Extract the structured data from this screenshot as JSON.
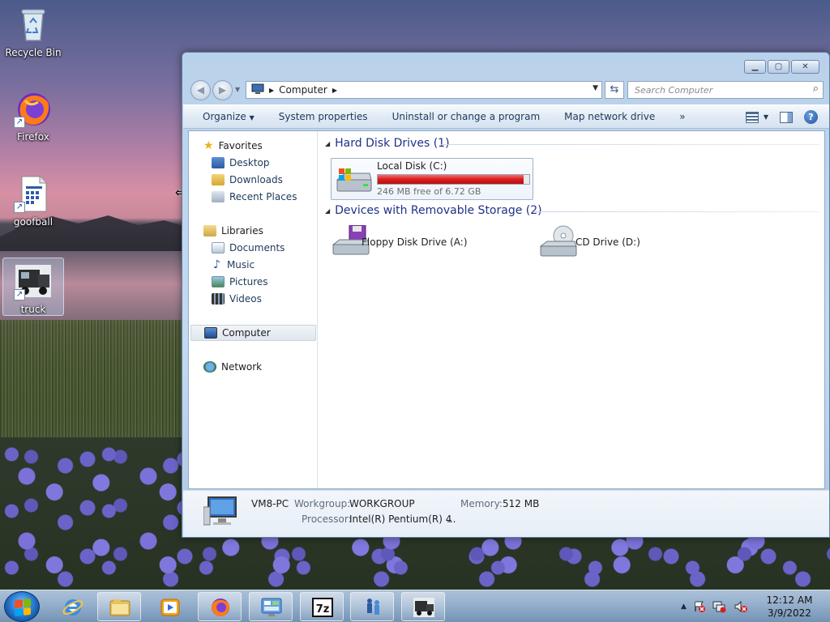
{
  "desktop": {
    "icons": [
      {
        "label": "Recycle Bin"
      },
      {
        "label": "Firefox"
      },
      {
        "label": "goofball"
      },
      {
        "label": "truck"
      }
    ]
  },
  "window": {
    "address": {
      "crumb": "Computer"
    },
    "search": {
      "placeholder": "Search Computer"
    },
    "commands": {
      "organize": "Organize",
      "system_properties": "System properties",
      "uninstall": "Uninstall or change a program",
      "map_drive": "Map network drive",
      "more": "»"
    },
    "nav_pane": {
      "favorites": "Favorites",
      "desktop": "Desktop",
      "downloads": "Downloads",
      "recent_places": "Recent Places",
      "libraries": "Libraries",
      "documents": "Documents",
      "music": "Music",
      "pictures": "Pictures",
      "videos": "Videos",
      "computer": "Computer",
      "network": "Network"
    },
    "groups": {
      "hard_disk": "Hard Disk Drives (1)",
      "removable": "Devices with Removable Storage (2)"
    },
    "drives": {
      "local_disk": {
        "name": "Local Disk (C:)",
        "free_text": "246 MB free of 6.72 GB",
        "used_fraction": 0.964
      },
      "floppy": {
        "name": "Floppy Disk Drive (A:)"
      },
      "cd": {
        "name": "CD Drive (D:)"
      }
    },
    "details": {
      "computer_name": "VM8-PC",
      "workgroup_label": "Workgroup:",
      "workgroup_value": "WORKGROUP",
      "memory_label": "Memory:",
      "memory_value": "512 MB",
      "processor_label": "Processor:",
      "processor_value": "Intel(R) Pentium(R) 4",
      "processor_ellipsis": "..."
    }
  },
  "taskbar": {
    "clock_time": "12:12 AM",
    "clock_date": "3/9/2022",
    "tray_arrow": "▲"
  },
  "colors": {
    "accent": "#1e3287",
    "capacity_bar": "#da1c1c",
    "link_text": "#1e395b"
  }
}
